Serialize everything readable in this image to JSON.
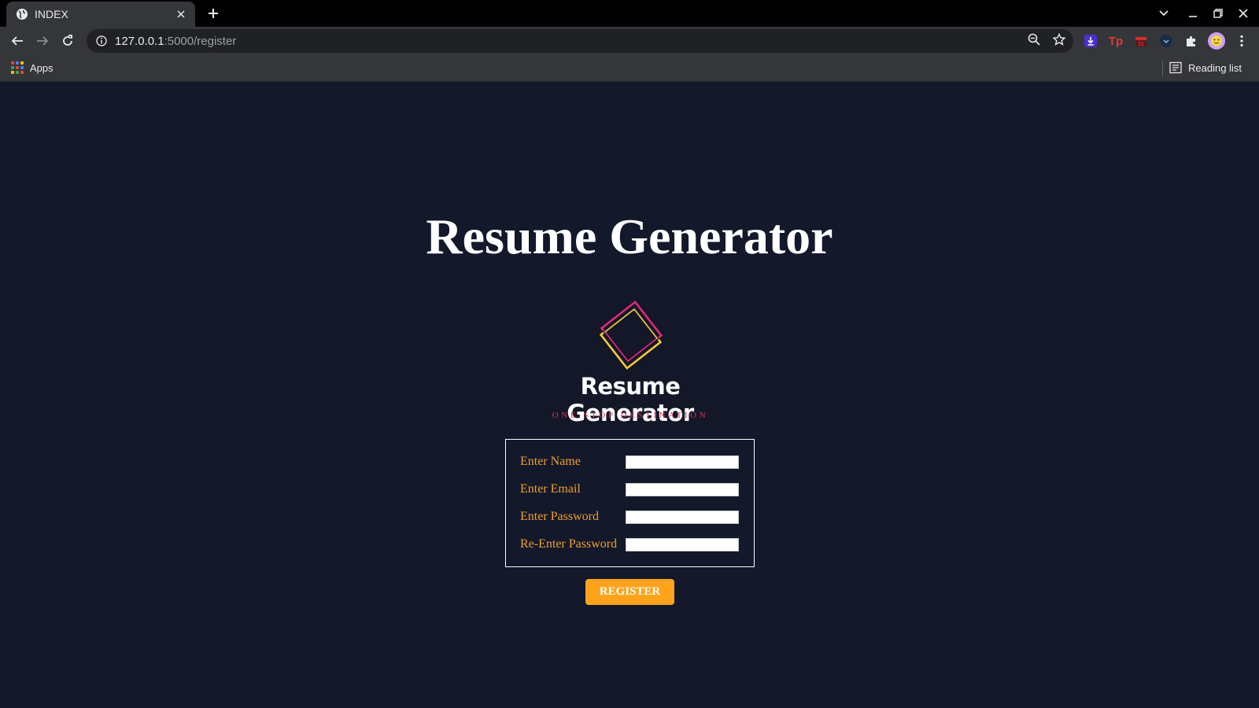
{
  "browser": {
    "tab_title": "INDEX",
    "url_host": "127.0.0.1",
    "url_rest": ":5000/register",
    "bookmarks": {
      "apps_label": "Apps",
      "reading_list_label": "Reading list"
    },
    "extensions": [
      "download-extension-icon",
      "tp-extension-icon",
      "calendar-extension-icon",
      "dark-extension-icon",
      "puzzle-icon"
    ]
  },
  "page": {
    "title": "Resume Generator",
    "logo": {
      "name": "Resume Generator",
      "tagline": "ONE STOP DESTINATION"
    },
    "form": {
      "fields": [
        {
          "label": "Enter Name",
          "value": ""
        },
        {
          "label": "Enter Email",
          "value": ""
        },
        {
          "label": "Enter Password",
          "value": ""
        },
        {
          "label": "Re-Enter Password",
          "value": ""
        }
      ],
      "submit_label": "REGISTER"
    }
  },
  "colors": {
    "page_background": "#13182b",
    "label_color": "#f0a02a",
    "button_color": "#ffa31a",
    "tagline_color": "#d7375a"
  }
}
